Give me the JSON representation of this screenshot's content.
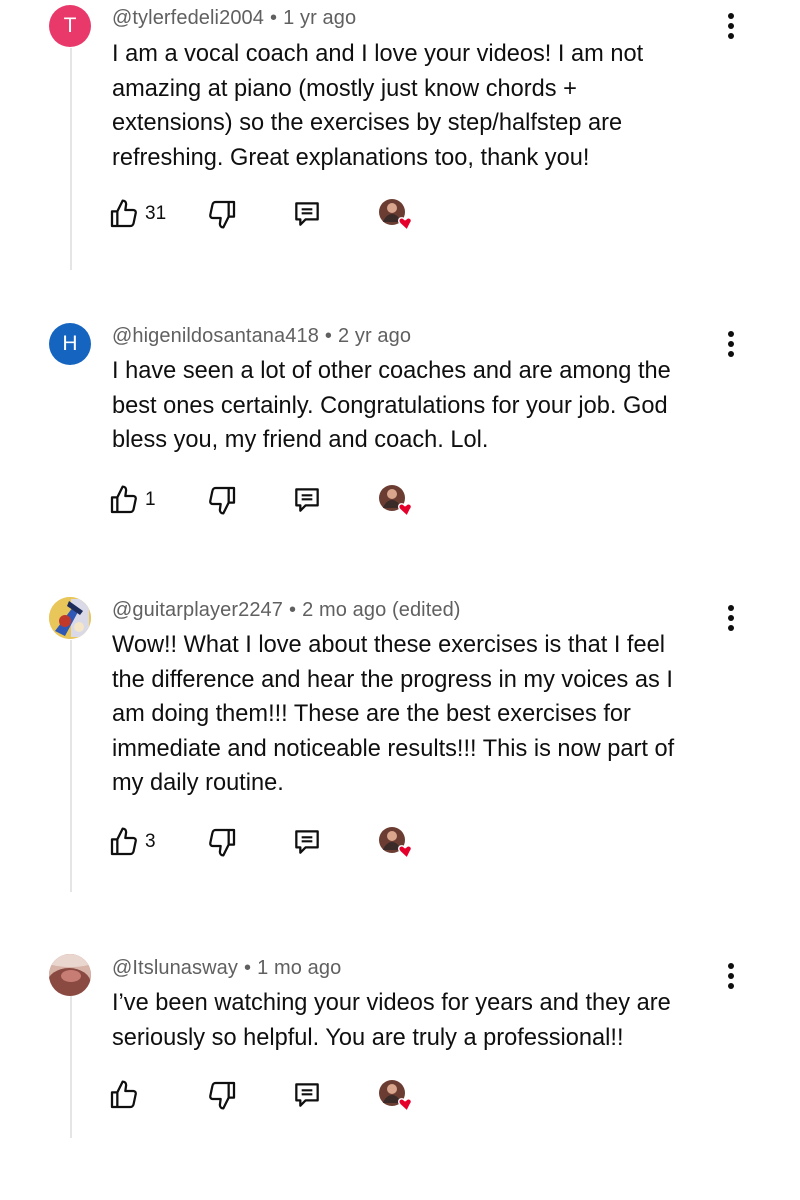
{
  "comments": [
    {
      "avatar_letter": "T",
      "avatar_color": "#e8396a",
      "handle": "@tylerfedeli2004",
      "time": "1 yr ago",
      "text": "I am a vocal coach and I love your videos!  I am not\namazing at piano (mostly just know chords +\nextensions) so the exercises by step/halfstep are\nrefreshing.  Great explanations too, thank you!",
      "likes": "31"
    },
    {
      "avatar_letter": "H",
      "avatar_color": "#1565c0",
      "handle": "@higenildosantana418",
      "time": "2 yr ago",
      "text": "I have seen a lot of other coaches and are among the\nbest ones certainly. Congratulations for your job. God\nbless you, my friend and coach. Lol.",
      "likes": "1"
    },
    {
      "avatar_letter": "",
      "avatar_color": "#e9c65a",
      "handle": "@guitarplayer2247",
      "time": "2 mo ago (edited)",
      "text": "Wow!! What I love about these exercises is that I feel\nthe difference and hear the progress in my voices as I\nam doing them!!! These are the best exercises for\nimmediate and noticeable results!!! This is now part of\nmy daily routine.",
      "likes": "3"
    },
    {
      "avatar_letter": "",
      "avatar_color": "#a8645a",
      "handle": "@Itslunasway",
      "time": "1 mo ago",
      "text": "I’ve been watching your videos for years and they are\nseriously so helpful. You are truly a professional!!",
      "likes": ""
    }
  ],
  "colors": {
    "meta_text": "#606060",
    "body_text": "#0f0f0f",
    "thread_line": "#e5e5e5",
    "heart": "#e5002b"
  },
  "icons": {
    "like": "thumbs-up-icon",
    "dislike": "thumbs-down-icon",
    "reply": "reply-comment-icon",
    "creator_heart": "creator-heart-icon",
    "menu": "more-vertical-icon"
  }
}
